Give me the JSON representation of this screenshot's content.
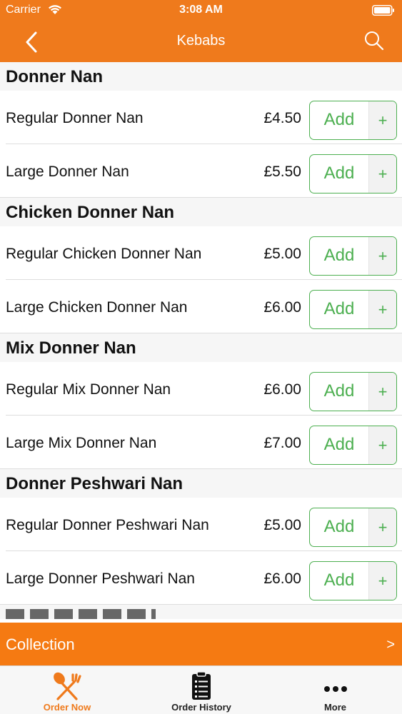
{
  "status_bar": {
    "carrier": "Carrier",
    "time": "3:08 AM"
  },
  "nav": {
    "title": "Kebabs"
  },
  "sections": [
    {
      "title": "Donner Nan",
      "items": [
        {
          "name": "Regular Donner Nan",
          "price": "£4.50"
        },
        {
          "name": "Large Donner Nan",
          "price": "£5.50"
        }
      ]
    },
    {
      "title": "Chicken Donner Nan",
      "items": [
        {
          "name": "Regular Chicken Donner Nan",
          "price": "£5.00"
        },
        {
          "name": "Large Chicken Donner Nan",
          "price": "£6.00"
        }
      ]
    },
    {
      "title": "Mix Donner Nan",
      "items": [
        {
          "name": "Regular Mix Donner Nan",
          "price": "£6.00"
        },
        {
          "name": "Large Mix Donner Nan",
          "price": "£7.00"
        }
      ]
    },
    {
      "title": "Donner Peshwari Nan",
      "items": [
        {
          "name": "Regular Donner Peshwari Nan",
          "price": "£5.00"
        },
        {
          "name": "Large Donner Peshwari Nan",
          "price": "£6.00"
        }
      ]
    }
  ],
  "buttons": {
    "add_label": "Add",
    "plus_label": "+"
  },
  "collection": {
    "label": "Collection",
    "arrow": ">"
  },
  "tabs": [
    {
      "label": "Order Now",
      "icon": "fork-spoon-icon",
      "active": true
    },
    {
      "label": "Order History",
      "icon": "clipboard-list-icon",
      "active": false
    },
    {
      "label": "More",
      "icon": "more-dots-icon",
      "active": false
    }
  ],
  "colors": {
    "brand_orange": "#ef7a1c",
    "add_green": "#4caf50"
  }
}
